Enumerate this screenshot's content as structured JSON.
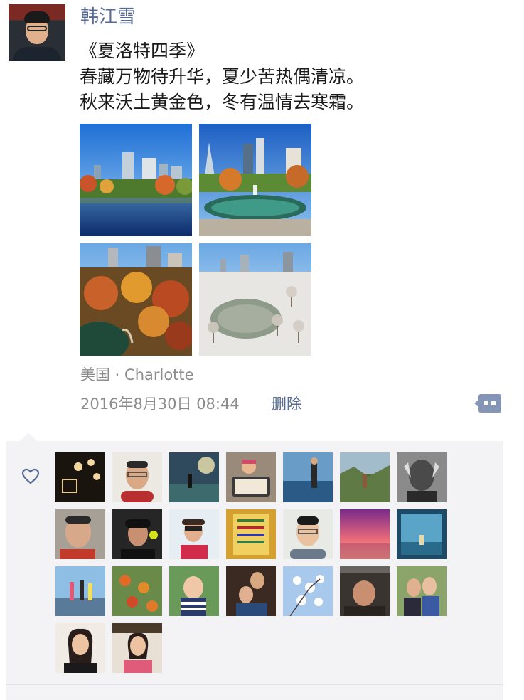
{
  "post": {
    "author": "韩江雪",
    "title_line": "《夏洛特四季》",
    "line1": "春藏万物待升华，夏少苦热偶清凉。",
    "line2": "秋来沃土黄金色，冬有温情去寒霜。",
    "location": "美国 · Charlotte",
    "timestamp": "2016年8月30日 08:44",
    "delete_label": "删除"
  },
  "photos": [
    "spring-skyline",
    "summer-fountain",
    "autumn-park",
    "winter-snow"
  ],
  "likes": {
    "icon": "heart-outline-icon",
    "count": 23
  },
  "colors": {
    "name_link": "#576b95",
    "meta_text": "#8c8c8c",
    "likes_bg": "#f3f3f5",
    "more_button": "#8595b5"
  }
}
